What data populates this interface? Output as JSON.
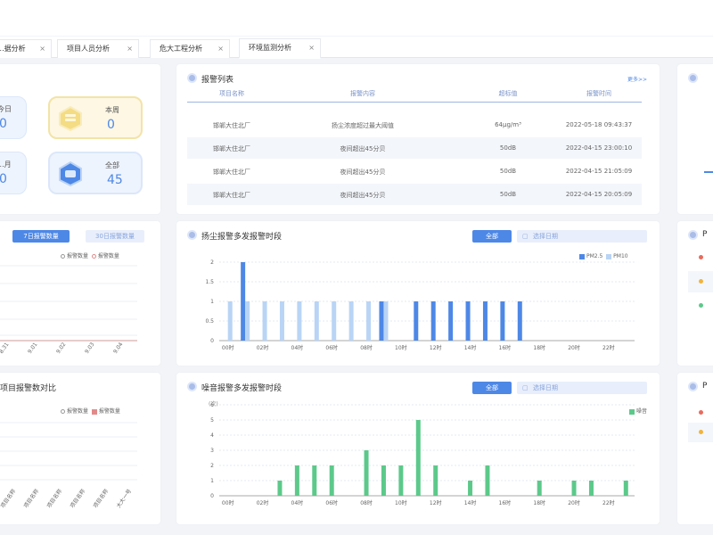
{
  "tabs": [
    {
      "label": "...据分析",
      "close": "×"
    },
    {
      "label": "项目人员分析",
      "close": "×"
    },
    {
      "label": "危大工程分析",
      "close": "×"
    },
    {
      "label": "环境监测分析",
      "close": "×"
    }
  ],
  "stats": {
    "today_label": "今日",
    "today_value": "0",
    "month_label": "...月",
    "month_value": "0",
    "week_label": "本周",
    "week_value": "0",
    "total_label": "全部",
    "total_value": "45"
  },
  "left_mid": {
    "btn_active": "7日报警数量",
    "btn_inactive": "30日报警数量",
    "legend1": "报警数量",
    "legend2": "报警数量",
    "xticks": [
      "8.31",
      "9.01",
      "9.02",
      "9.03",
      "9.04"
    ]
  },
  "left_bottom": {
    "title": "项目报警数对比",
    "legend1": "报警数量",
    "legend2": "报警数量",
    "xticks": [
      "项目名称",
      "项目名称",
      "项目名称",
      "项目名称",
      "项目名称",
      "大大一号"
    ]
  },
  "alarm_list": {
    "title": "报警列表",
    "more": "更多>>",
    "headers": [
      "项目名称",
      "报警内容",
      "超标值",
      "报警时间"
    ],
    "rows": [
      [
        "邯郸大住北厂",
        "扬尘浓度超过最大阈值",
        "64μg/m³",
        "2022-05-18 09:43:37"
      ],
      [
        "邯郸大住北厂",
        "夜间超出45分贝",
        "50dB",
        "2022-04-15 23:00:10"
      ],
      [
        "邯郸大住北厂",
        "夜间超出45分贝",
        "50dB",
        "2022-04-15 21:05:09"
      ],
      [
        "邯郸大住北厂",
        "夜间超出45分贝",
        "50dB",
        "2022-04-15 20:05:09"
      ]
    ]
  },
  "dust_chart": {
    "title": "扬尘报警多发报警时段",
    "btn_active": "全部",
    "btn_inactive": "选择日期",
    "colors": {
      "pm25": "#4e88e6",
      "pm10": "#b9d4f5"
    }
  },
  "noise_chart": {
    "title": "噪音报警多发报警时段",
    "btn_active": "全部",
    "btn_inactive": "选择日期",
    "unit": "(次)",
    "colors": {
      "noise": "#5cc98a"
    }
  },
  "right_col": {
    "label1": "P",
    "label2": "P"
  },
  "chart_data": [
    {
      "type": "bar",
      "title": "扬尘报警多发报警时段",
      "x": [
        "00时",
        "01时",
        "02时",
        "03时",
        "04时",
        "05时",
        "06时",
        "07时",
        "08时",
        "09时",
        "10时",
        "11时",
        "12时",
        "13时",
        "14时",
        "15时",
        "16时",
        "17时",
        "18时",
        "19时",
        "20时",
        "21时",
        "22时",
        "23时"
      ],
      "xticks": [
        "00时",
        "02时",
        "04时",
        "06时",
        "08时",
        "10时",
        "12时",
        "14时",
        "16时",
        "18时",
        "20时",
        "22时"
      ],
      "series": [
        {
          "name": "PM2.5",
          "values": [
            0,
            2,
            0,
            0,
            0,
            0,
            0,
            0,
            0,
            1,
            0,
            1,
            1,
            1,
            1,
            1,
            1,
            1,
            0,
            0,
            0,
            0,
            0,
            0
          ]
        },
        {
          "name": "PM10",
          "values": [
            1,
            1,
            1,
            1,
            1,
            1,
            1,
            1,
            1,
            1,
            0,
            0,
            0,
            0,
            0,
            0,
            0,
            0,
            0,
            0,
            0,
            0,
            0,
            0
          ]
        }
      ],
      "ylim": [
        0,
        2
      ],
      "yticks": [
        "0",
        "0.5",
        "1",
        "1.5",
        "2"
      ]
    },
    {
      "type": "bar",
      "title": "噪音报警多发报警时段",
      "x": [
        "00时",
        "01时",
        "02时",
        "03时",
        "04时",
        "05时",
        "06时",
        "07时",
        "08时",
        "09时",
        "10时",
        "11时",
        "12时",
        "13时",
        "14时",
        "15时",
        "16时",
        "17时",
        "18时",
        "19时",
        "20时",
        "21时",
        "22时",
        "23时"
      ],
      "xticks": [
        "00时",
        "02时",
        "04时",
        "06时",
        "08时",
        "10时",
        "12时",
        "14时",
        "16时",
        "18时",
        "20时",
        "22时"
      ],
      "series": [
        {
          "name": "噪音",
          "values": [
            0,
            0,
            0,
            1,
            2,
            2,
            2,
            0,
            3,
            2,
            2,
            5,
            2,
            0,
            1,
            2,
            0,
            0,
            1,
            0,
            1,
            1,
            0,
            1
          ]
        }
      ],
      "ylabel": "(次)",
      "ylim": [
        0,
        6
      ],
      "yticks": [
        "0",
        "1",
        "2",
        "3",
        "4",
        "5",
        "6"
      ]
    }
  ]
}
